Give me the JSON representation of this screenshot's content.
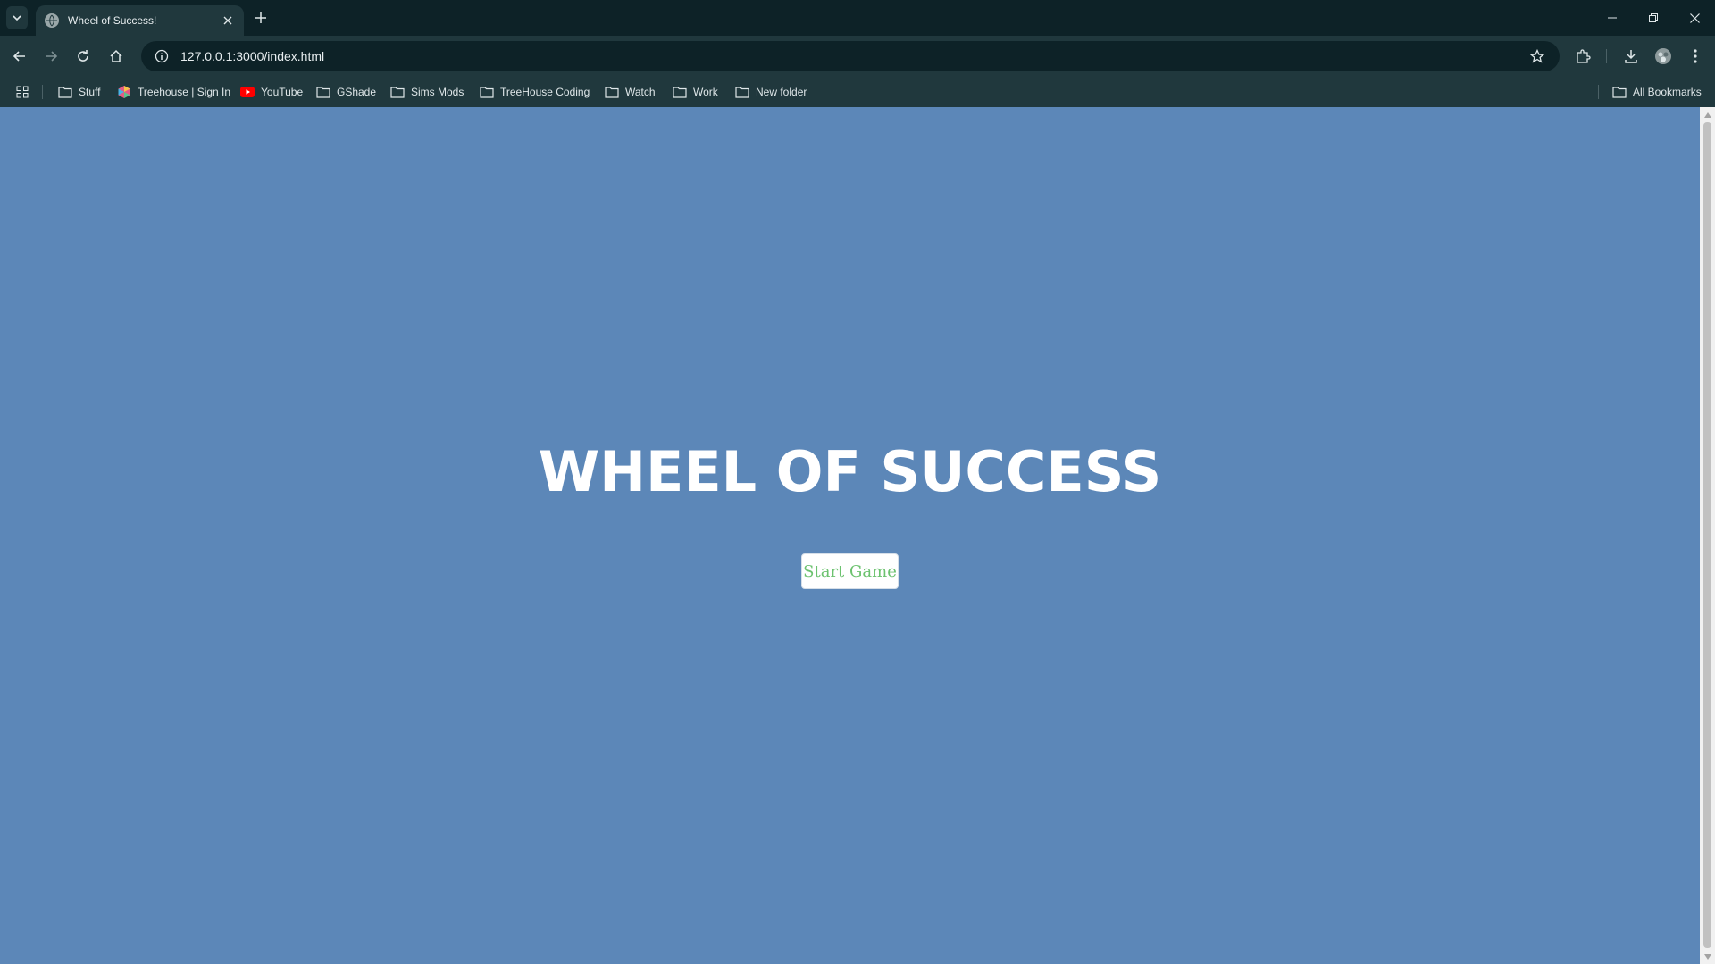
{
  "browser": {
    "tab": {
      "title": "Wheel of Success!",
      "favicon": "globe-icon"
    },
    "address_bar": {
      "url": "127.0.0.1:3000/index.html"
    },
    "bookmarks": [
      {
        "label": "Stuff",
        "icon": "folder-icon"
      },
      {
        "label": "Treehouse | Sign In",
        "icon": "treehouse-icon"
      },
      {
        "label": "YouTube",
        "icon": "youtube-icon"
      },
      {
        "label": "GShade",
        "icon": "folder-icon"
      },
      {
        "label": "Sims Mods",
        "icon": "folder-icon"
      },
      {
        "label": "TreeHouse Coding",
        "icon": "folder-icon"
      },
      {
        "label": "Watch",
        "icon": "folder-icon"
      },
      {
        "label": "Work",
        "icon": "folder-icon"
      },
      {
        "label": "New folder",
        "icon": "folder-icon"
      }
    ],
    "all_bookmarks_label": "All Bookmarks",
    "colors": {
      "tabbar": "#0d2227",
      "toolbar": "#20383d"
    }
  },
  "page": {
    "title": "WHEEL OF SUCCESS",
    "start_button_label": "Start Game",
    "colors": {
      "background": "#5c87b8",
      "title": "#ffffff",
      "button_text": "#6cc26f",
      "button_bg": "#ffffff"
    }
  }
}
